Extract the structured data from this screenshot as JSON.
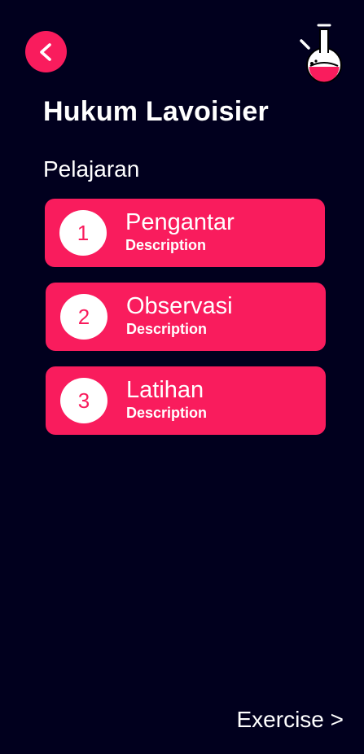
{
  "header": {
    "back_icon": "chevron-left-icon",
    "logo_icon": "flask-icon"
  },
  "page": {
    "title": "Hukum Lavoisier",
    "section_label": "Pelajaran"
  },
  "lessons": [
    {
      "number": "1",
      "title": "Pengantar",
      "description": "Description"
    },
    {
      "number": "2",
      "title": "Observasi",
      "description": "Description"
    },
    {
      "number": "3",
      "title": "Latihan",
      "description": "Description"
    }
  ],
  "footer": {
    "exercise_label": "Exercise >"
  },
  "colors": {
    "background": "#01001e",
    "accent": "#f91c5d",
    "text": "#ffffff"
  }
}
